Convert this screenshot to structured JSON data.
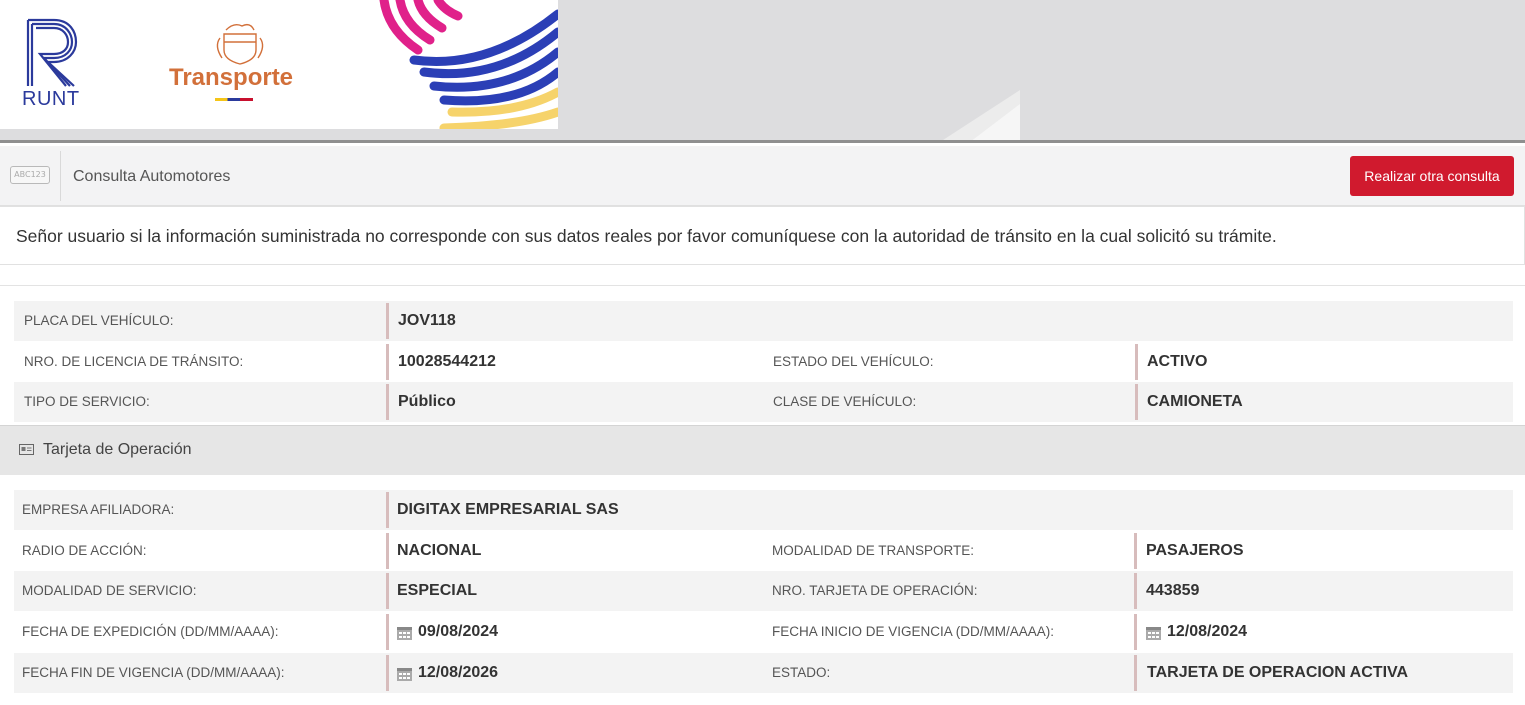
{
  "header": {
    "runt_logo_text": "RUNT",
    "transporte_logo_text": "Transporte"
  },
  "toolbar": {
    "plate_icon_text": "ABC123",
    "title": "Consulta Automotores",
    "button_label": "Realizar otra consulta"
  },
  "notice": {
    "text": "Señor usuario si la información suministrada no corresponde con sus datos reales por favor comuníquese con la autoridad de tránsito en la cual solicitó su trámite."
  },
  "vehicle": {
    "placa_label": "PLACA DEL VEHÍCULO:",
    "placa_value": "JOV118",
    "licencia_label": "NRO. DE LICENCIA DE TRÁNSITO:",
    "licencia_value": "10028544212",
    "estado_label": "ESTADO DEL VEHÍCULO:",
    "estado_value": "ACTIVO",
    "servicio_label": "TIPO DE SERVICIO:",
    "servicio_value": "Público",
    "clase_label": "CLASE DE VEHÍCULO:",
    "clase_value": "CAMIONETA"
  },
  "tarjeta": {
    "section_title": "Tarjeta de Operación",
    "empresa_label": "EMPRESA AFILIADORA:",
    "empresa_value": "DIGITAX EMPRESARIAL SAS",
    "radio_label": "RADIO DE ACCIÓN:",
    "radio_value": "NACIONAL",
    "modalidad_transporte_label": "MODALIDAD DE TRANSPORTE:",
    "modalidad_transporte_value": "PASAJEROS",
    "modalidad_servicio_label": "MODALIDAD DE SERVICIO:",
    "modalidad_servicio_value": "ESPECIAL",
    "nro_tarjeta_label": "NRO. TARJETA DE OPERACIÓN:",
    "nro_tarjeta_value": "443859",
    "fecha_expedicion_label": "FECHA DE EXPEDICIÓN (DD/MM/AAAA):",
    "fecha_expedicion_value": "09/08/2024",
    "fecha_inicio_label": "FECHA INICIO DE VIGENCIA (DD/MM/AAAA):",
    "fecha_inicio_value": "12/08/2024",
    "fecha_fin_label": "FECHA FIN DE VIGENCIA (DD/MM/AAAA):",
    "fecha_fin_value": "12/08/2026",
    "estado_label": "ESTADO:",
    "estado_value": "TARJETA DE OPERACION ACTIVA"
  },
  "colors": {
    "button_red": "#d01a2e",
    "runt_blue": "#2b3a9c",
    "transporte_orange": "#d2703a",
    "row_shade": "#f3f3f3",
    "value_bar": "#d7bcbc"
  }
}
